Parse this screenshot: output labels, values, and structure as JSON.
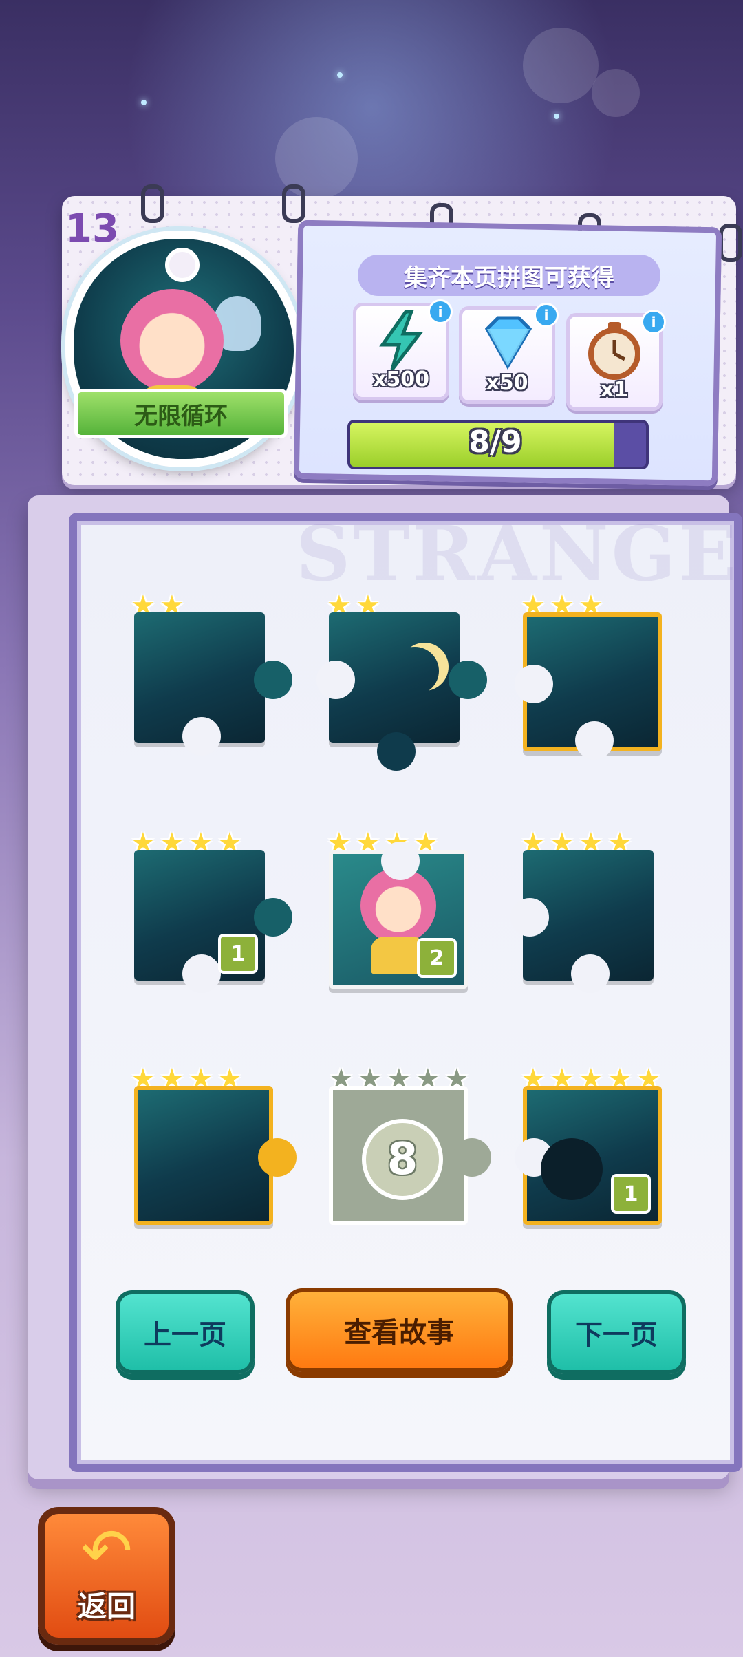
{
  "page": {
    "page_number": "13",
    "watermark": "STRANGE"
  },
  "badge": {
    "label": "无限循环"
  },
  "rewards": {
    "title": "集齐本页拼图可获得",
    "items": [
      {
        "icon": "lightning-icon",
        "count": "x500"
      },
      {
        "icon": "diamond-icon",
        "count": "x50"
      },
      {
        "icon": "stopwatch-icon",
        "count": "x1"
      }
    ],
    "progress": {
      "text": "8/9",
      "fraction": 0.8889
    }
  },
  "puzzle": {
    "pieces": [
      {
        "stars": 2,
        "count": ""
      },
      {
        "stars": 2,
        "count": ""
      },
      {
        "stars": 3,
        "count": ""
      },
      {
        "stars": 4,
        "count": "1"
      },
      {
        "stars": 4,
        "count": "2"
      },
      {
        "stars": 4,
        "count": ""
      },
      {
        "stars": 4,
        "count": ""
      },
      {
        "stars": 5,
        "locked_number": "8"
      },
      {
        "stars": 5,
        "count": "1"
      }
    ]
  },
  "buttons": {
    "prev": "上一页",
    "story": "查看故事",
    "next": "下一页",
    "back": "返回"
  },
  "colors": {
    "accent_teal": "#1fbfa8",
    "accent_orange": "#ff7a11",
    "star_yellow": "#ffd83a",
    "progress_green": "#9bcf2a"
  }
}
